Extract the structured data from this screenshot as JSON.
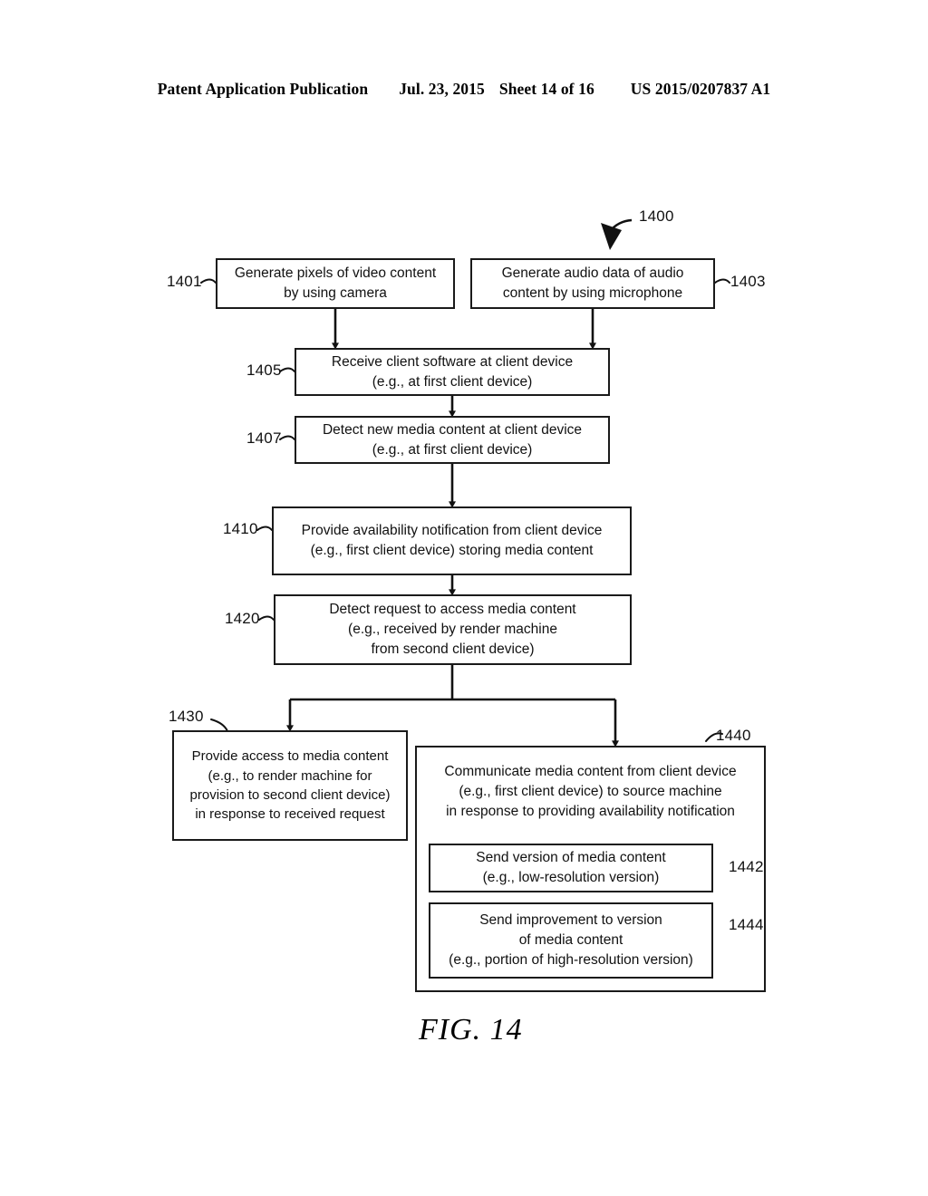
{
  "header": {
    "publication": "Patent Application Publication",
    "date": "Jul. 23, 2015",
    "sheet": "Sheet 14 of 16",
    "patent_number": "US 2015/0207837 A1"
  },
  "figure": {
    "caption": "FIG. 14",
    "diagram_ref": "1400"
  },
  "nodes": [
    {
      "ref": "1401",
      "ref_side": "left",
      "lines": [
        "Generate pixels of video content",
        "by using camera"
      ],
      "text": "Generate pixels of video content by using camera"
    },
    {
      "ref": "1403",
      "ref_side": "right",
      "lines": [
        "Generate audio data of audio",
        "content by using microphone"
      ],
      "text": "Generate audio data of audio content by using microphone"
    },
    {
      "ref": "1405",
      "ref_side": "left",
      "lines": [
        "Receive client software at client device",
        "(e.g., at first client device)"
      ],
      "text": "Receive client software at client device (e.g., at first client device)"
    },
    {
      "ref": "1407",
      "ref_side": "left",
      "lines": [
        "Detect new media content at client device",
        "(e.g., at first client device)"
      ],
      "text": "Detect new media content at client device (e.g., at first client device)"
    },
    {
      "ref": "1410",
      "ref_side": "left",
      "lines": [
        "Provide availability notification from client device",
        "(e.g., first client device) storing media content"
      ],
      "text": "Provide availability notification from client device (e.g., first client device) storing media content"
    },
    {
      "ref": "1420",
      "ref_side": "left",
      "lines": [
        "Detect request to access media content",
        "(e.g., received by render machine",
        "from second client device)"
      ],
      "text": "Detect request to access media content (e.g., received by render machine from second client device)"
    },
    {
      "ref": "1430",
      "ref_side": "top-left",
      "lines": [
        "Provide access to media content",
        "(e.g., to render machine for",
        "provision to second client device)",
        "in response to received request"
      ],
      "text": "Provide access to media content (e.g., to render machine for provision to second client device) in response to received request"
    },
    {
      "ref": "1440",
      "ref_side": "top-right",
      "lines": [
        "Communicate media content from client device",
        "(e.g., first client device) to source machine",
        "in response to providing availability notification"
      ],
      "text": "Communicate media content from client device (e.g., first client device) to source machine in response to providing availability notification"
    },
    {
      "ref": "1442",
      "ref_side": "right",
      "lines": [
        "Send version of media content",
        "(e.g., low-resolution version)"
      ],
      "text": "Send version of media content (e.g., low-resolution version)"
    },
    {
      "ref": "1444",
      "ref_side": "right",
      "lines": [
        "Send improvement to version",
        "of media content",
        "(e.g., portion of high-resolution version)"
      ],
      "text": "Send improvement to version of media content (e.g., portion of high-resolution version)"
    }
  ],
  "colors": {
    "ink": "#111111",
    "stroke": "#1a1a1a",
    "paper": "#ffffff"
  }
}
